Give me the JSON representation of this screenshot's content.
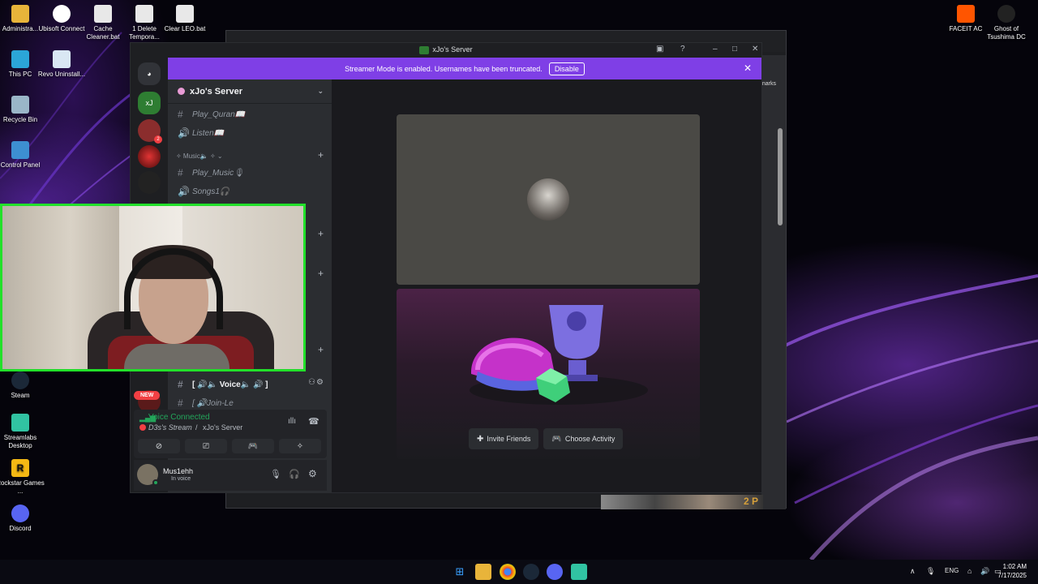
{
  "desktop": {
    "left_icons": [
      {
        "label": "Administra...",
        "icon": "folder-icon"
      },
      {
        "label": "This PC",
        "icon": "pc-icon"
      },
      {
        "label": "Recycle Bin",
        "icon": "recycle-bin-icon"
      },
      {
        "label": "Control Panel",
        "icon": "control-panel-icon"
      },
      {
        "label": "Steam",
        "icon": "steam-icon"
      },
      {
        "label": "Streamlabs Desktop",
        "icon": "streamlabs-icon"
      },
      {
        "label": "Rockstar Games ...",
        "icon": "rockstar-icon"
      },
      {
        "label": "Discord",
        "icon": "discord-icon"
      }
    ],
    "top_icons": [
      {
        "label": "Ubisoft Connect",
        "icon": "ubisoft-icon"
      },
      {
        "label": "Cache Cleaner.bat",
        "icon": "bat-file-icon"
      },
      {
        "label": "1 Delete Tempora...",
        "icon": "bat-file-icon"
      },
      {
        "label": "Clear LEO.bat",
        "icon": "bat-file-icon"
      },
      {
        "label": "Revo Uninstall...",
        "icon": "revo-icon"
      }
    ],
    "right_icons": [
      {
        "label": "FACEIT AC",
        "icon": "faceit-icon"
      },
      {
        "label": "Ghost of Tsushima DC",
        "icon": "ghost-icon"
      }
    ]
  },
  "browser": {
    "bookmarks_fragment": "narks",
    "corner_text": "2 P"
  },
  "discord": {
    "window_title": "xJo's Server",
    "banner": {
      "text": "Streamer Mode is enabled. Usernames have been truncated.",
      "button": "Disable"
    },
    "server_name": "xJo's Server",
    "channels": [
      {
        "symbol": "#",
        "name": "Play_Quran📖"
      },
      {
        "symbol": "🔊",
        "name": "Listen📖"
      }
    ],
    "category_music": "✧ Music🔈 ✧ ⌄",
    "music_channels": [
      {
        "symbol": "#",
        "name": "Play_Music🎙"
      },
      {
        "symbol": "🔊",
        "name": "Songs1🎧"
      }
    ],
    "voice_channel": "[ 🔊🔈 Voice🔈 🔊 ]",
    "join_channel": "[ 🔊Join-Le",
    "new_badge": "NEW",
    "voice_panel": {
      "status": "Voice Connected",
      "stream": "D3s's Stream",
      "server": "xJo's Server"
    },
    "user": {
      "name": "Mus1ehh",
      "status": "In voice"
    },
    "actions": {
      "invite": "Invite Friends",
      "activity": "Choose Activity"
    }
  },
  "taskbar": {
    "lang": "ENG",
    "time": "1:02 AM",
    "date": "7/17/2025"
  },
  "colors": {
    "blurple": "#7f3fe6",
    "green": "#23a55a",
    "cam_border": "#22e02a"
  }
}
